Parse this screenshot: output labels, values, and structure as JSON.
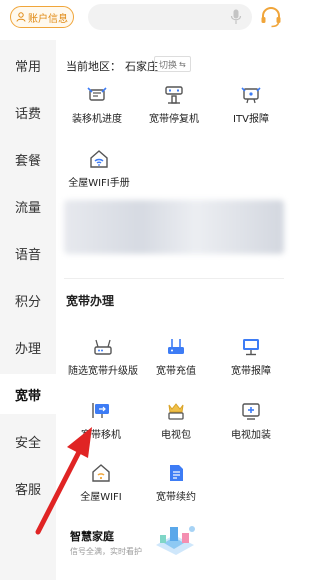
{
  "header": {
    "account_label": "账户信息",
    "search_placeholder": ""
  },
  "sidebar": {
    "items": [
      {
        "label": "常用",
        "active": false
      },
      {
        "label": "话费",
        "active": false
      },
      {
        "label": "套餐",
        "active": false
      },
      {
        "label": "流量",
        "active": false
      },
      {
        "label": "语音",
        "active": false
      },
      {
        "label": "积分",
        "active": false
      },
      {
        "label": "办理",
        "active": false
      },
      {
        "label": "宽带",
        "active": true
      },
      {
        "label": "安全",
        "active": false
      },
      {
        "label": "客服",
        "active": false
      }
    ]
  },
  "region": {
    "label": "当前地区：",
    "city": "石家庄",
    "switch_label": "切换"
  },
  "quick_services": [
    {
      "label": "装移机进度",
      "icon": "tools-icon"
    },
    {
      "label": "宽带停复机",
      "icon": "router-pause-icon"
    },
    {
      "label": "ITV报障",
      "icon": "tv-repair-icon"
    },
    {
      "label": "全屋WIFI手册",
      "icon": "home-wifi-icon"
    }
  ],
  "broadband_section": {
    "title": "宽带办理",
    "items": [
      {
        "label": "随选宽带升级版",
        "icon": "router-icon"
      },
      {
        "label": "宽带充值",
        "icon": "router-recharge-icon"
      },
      {
        "label": "宽带报障",
        "icon": "monitor-icon"
      },
      {
        "label": "宽带移机",
        "icon": "screen-move-icon"
      },
      {
        "label": "电视包",
        "icon": "crown-tv-icon"
      },
      {
        "label": "电视加装",
        "icon": "tv-add-icon"
      },
      {
        "label": "全屋WIFI",
        "icon": "home-wifi-icon"
      },
      {
        "label": "宽带续约",
        "icon": "document-icon"
      }
    ]
  },
  "smart_home": {
    "title": "智慧家庭",
    "subtitle": "信号全满，实时看护"
  },
  "colors": {
    "accent_orange": "#f0a53a",
    "icon_blue": "#3d7cf5",
    "annotation_red": "#e02424"
  }
}
